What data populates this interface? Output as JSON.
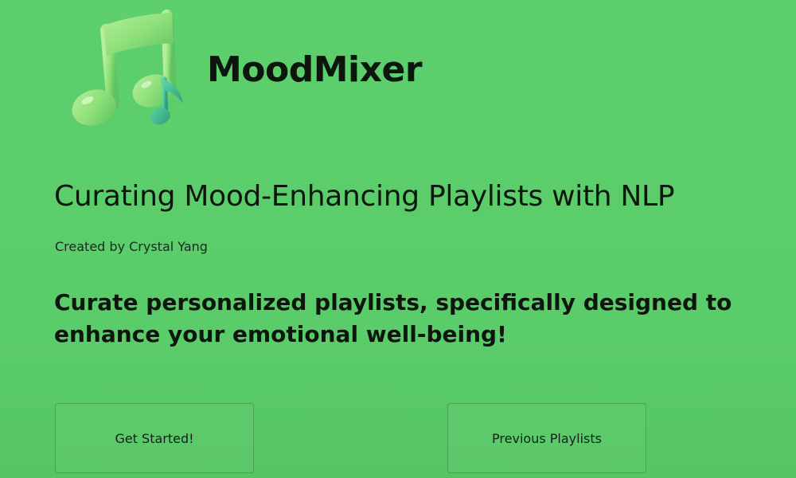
{
  "header": {
    "logo_icon": "music-note-icon",
    "app_name": "MoodMixer"
  },
  "hero": {
    "headline": "Curating Mood-Enhancing Playlists with NLP",
    "byline": "Created by Crystal Yang",
    "tagline": "Curate personalized playlists, specifically designed to enhance your emotional well-being!"
  },
  "actions": {
    "get_started_label": "Get Started!",
    "previous_playlists_label": "Previous Playlists"
  },
  "colors": {
    "background": "#5dcf6d",
    "text": "#0c160d",
    "note_primary": "#8ee07a",
    "note_secondary": "#3fb48f"
  }
}
